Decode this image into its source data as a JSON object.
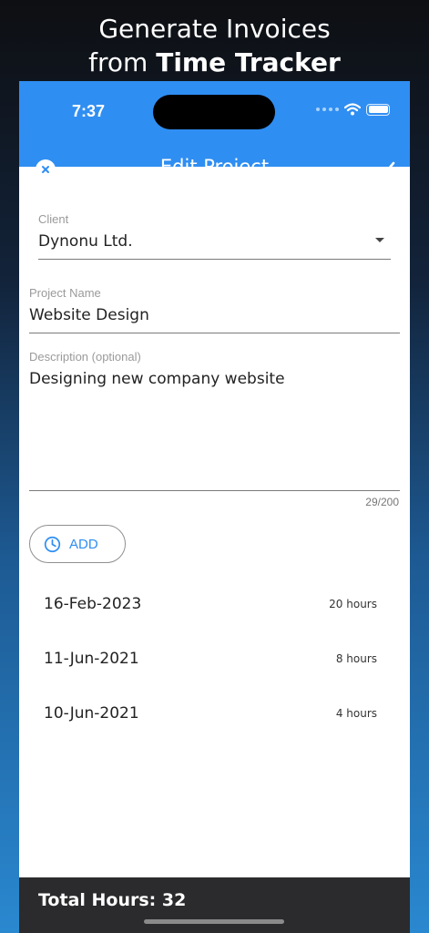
{
  "promo": {
    "line1": "Generate Invoices",
    "line2_prefix": "from ",
    "line2_bold": "Time Tracker"
  },
  "status_bar": {
    "time": "7:37"
  },
  "app_bar": {
    "title": "Edit Project",
    "close_icon": "close-circle-icon",
    "confirm_icon": "checkmark-icon",
    "color": "#2f8ef2"
  },
  "form": {
    "client": {
      "label": "Client",
      "value": "Dynonu Ltd."
    },
    "project_name": {
      "label": "Project Name",
      "value": "Website Design"
    },
    "description": {
      "label": "Description (optional)",
      "value": "Designing new company website",
      "counter": "29/200"
    }
  },
  "add_button": {
    "label": "ADD",
    "icon": "clock-icon"
  },
  "entries": [
    {
      "date": "16-Feb-2023",
      "hours": "20 hours"
    },
    {
      "date": "11-Jun-2021",
      "hours": "8 hours"
    },
    {
      "date": "10-Jun-2021",
      "hours": "4 hours"
    }
  ],
  "footer": {
    "total": "Total Hours: 32"
  }
}
